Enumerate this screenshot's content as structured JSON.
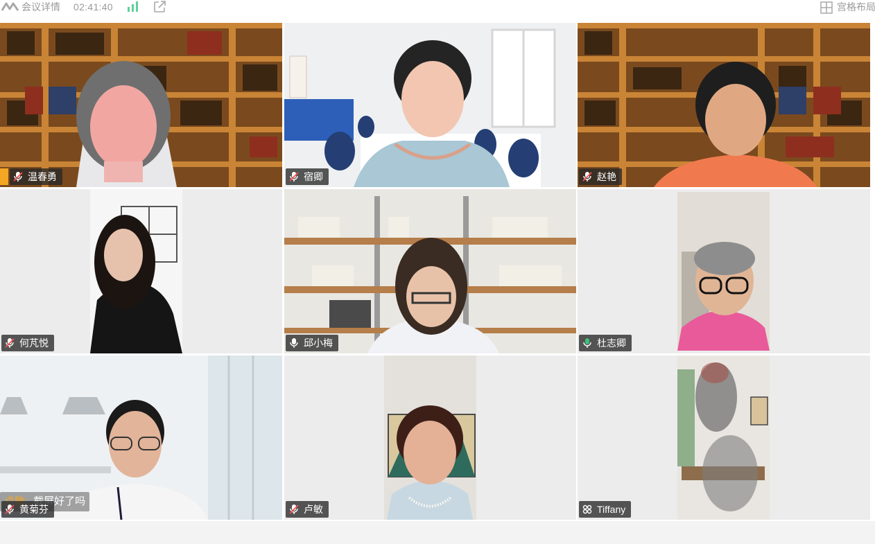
{
  "topbar": {
    "meeting_details_label": "会议详情",
    "elapsed_time": "02:41:40",
    "layout_label": "宫格布局"
  },
  "chat": {
    "sender": "卢敏:",
    "message": "截屏好了吗"
  },
  "participants": [
    {
      "name": "温春勇",
      "mic": "muted",
      "host": true
    },
    {
      "name": "宿卿",
      "mic": "muted"
    },
    {
      "name": "赵艳",
      "mic": "muted"
    },
    {
      "name": "何芃悦",
      "mic": "muted"
    },
    {
      "name": "邱小梅",
      "mic": "on"
    },
    {
      "name": "杜志卿",
      "mic": "speaking",
      "active": true
    },
    {
      "name": "黄菊芬",
      "mic": "muted"
    },
    {
      "name": "卢敏",
      "mic": "muted"
    },
    {
      "name": "Tiffany",
      "mic": "link"
    }
  ],
  "colors": {
    "active_border": "#3dbf7a",
    "host_badge": "#f5a623",
    "speaking_mic": "#3dbf7a"
  }
}
